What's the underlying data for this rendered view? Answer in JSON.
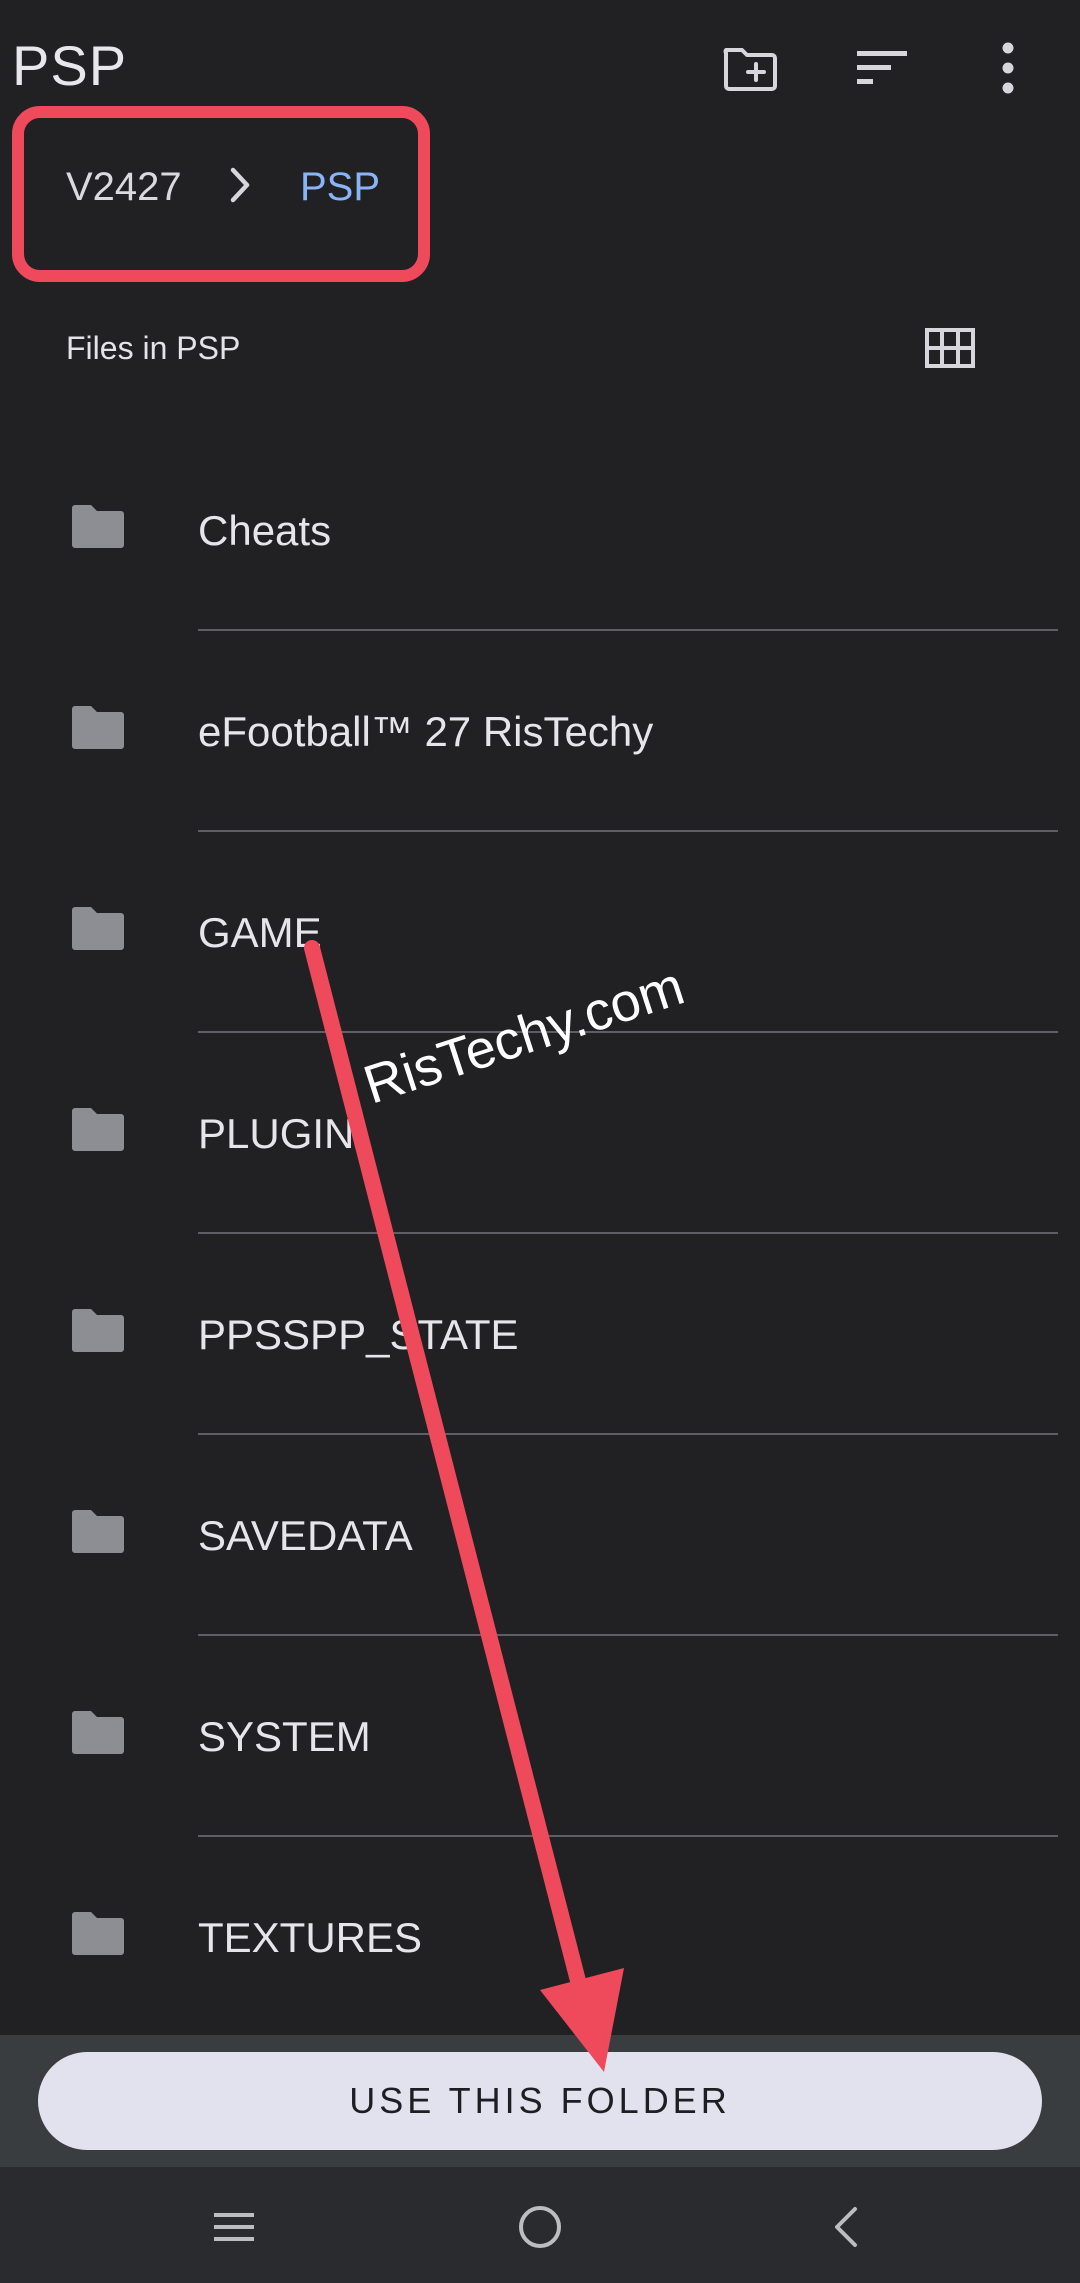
{
  "app_bar": {
    "title": "PSP",
    "actions": [
      {
        "name": "new-folder-icon"
      },
      {
        "name": "sort-icon"
      },
      {
        "name": "more-options-icon"
      }
    ]
  },
  "breadcrumb": {
    "root": "V2427",
    "separator_icon": "chevron-right-icon",
    "current": "PSP",
    "highlight_color": "#ef4a5c",
    "current_color": "#8ab4f8"
  },
  "list_header": {
    "label": "Files in PSP",
    "view_toggle_icon": "grid-view-icon"
  },
  "folders": [
    {
      "name": "Cheats"
    },
    {
      "name": "eFootball™ 27 RisTechy"
    },
    {
      "name": "GAME"
    },
    {
      "name": "PLUGIN"
    },
    {
      "name": "PPSSPP_STATE"
    },
    {
      "name": "SAVEDATA"
    },
    {
      "name": "SYSTEM"
    },
    {
      "name": "TEXTURES"
    }
  ],
  "action": {
    "use_folder_label": "USE THIS FOLDER"
  },
  "system_nav": {
    "buttons": [
      "menu-icon",
      "home-icon",
      "back-icon"
    ]
  },
  "overlay": {
    "watermark": "RisTechy.com",
    "arrow_color": "#ef4a5c"
  }
}
